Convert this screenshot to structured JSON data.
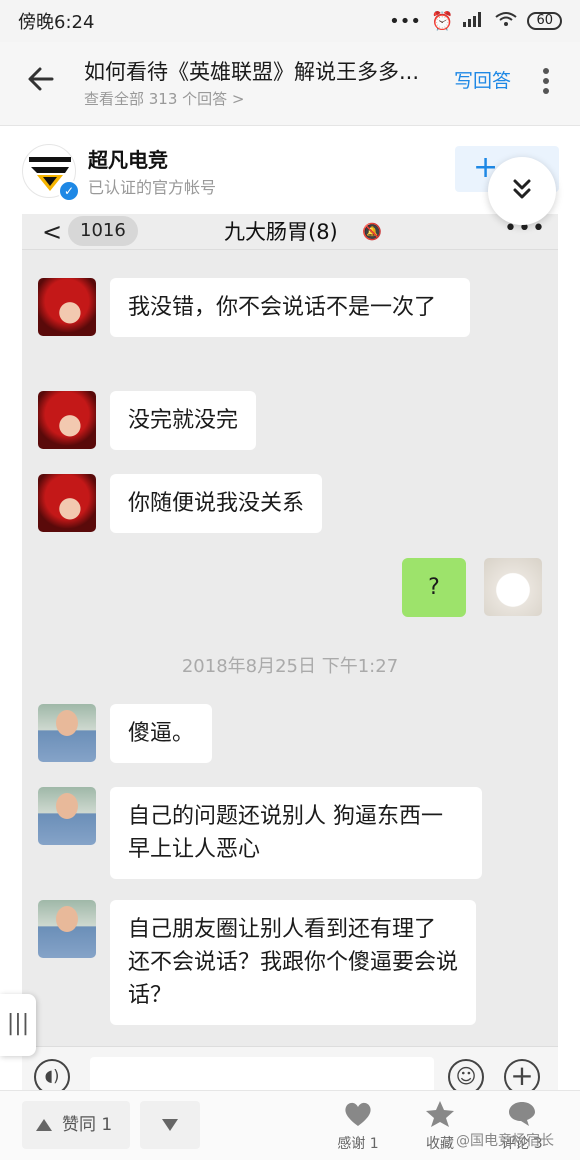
{
  "status_bar": {
    "time": "傍晚6:24",
    "battery": "60"
  },
  "question": {
    "title": "如何看待《英雄联盟》解说王多多...",
    "subtitle": "查看全部 313 个回答 >",
    "write_answer": "写回答"
  },
  "author": {
    "name": "超凡电竞",
    "description": "已认证的官方帐号",
    "follow_label": "+"
  },
  "chat": {
    "back_count": "1016",
    "title": "九大肠胃(8)",
    "messages": [
      {
        "text": "我没错，你不会说话不是一次了"
      },
      {
        "text": "没完就没完"
      },
      {
        "text": "你随便说我没关系"
      },
      {
        "text": "?"
      },
      {
        "text": "傻逼。"
      },
      {
        "text": "自己的问题还说别人 狗逼东西一早上让人恶心"
      },
      {
        "text": "自己朋友圈让别人看到还有理了 还不会说话？我跟你个傻逼要会说话？"
      }
    ],
    "timestamp": "2018年8月25日 下午1:27"
  },
  "bottom_bar": {
    "upvote_label": "赞同 1",
    "thanks_label": "感谢 1",
    "collect_label": "收藏",
    "comment_label": "评论 3"
  },
  "watermark": "@国电竞杨宿长",
  "colors": {
    "accent": "#1e88e5",
    "chat_bg": "#ebebeb",
    "bubble_green": "#9de36b"
  }
}
